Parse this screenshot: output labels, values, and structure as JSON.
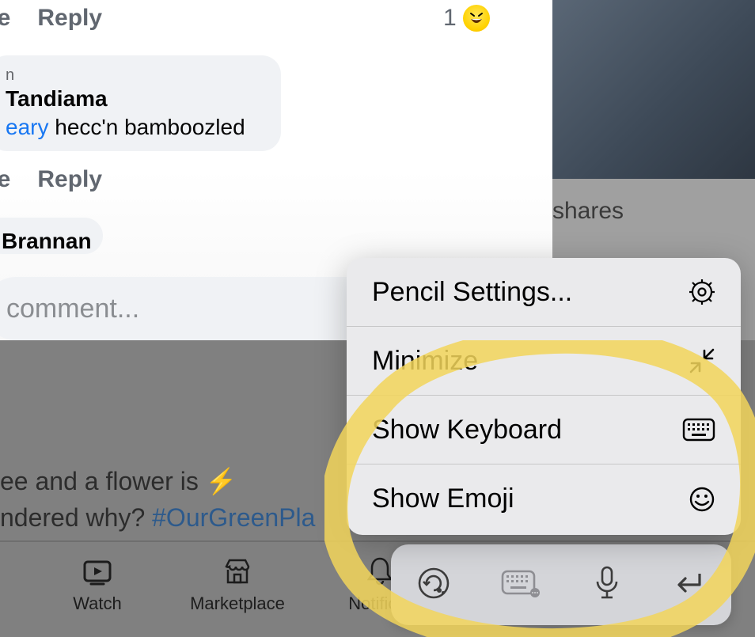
{
  "comments": {
    "actions": {
      "like": "ke",
      "reply": "Reply"
    },
    "reaction_count": "1",
    "bubble1": {
      "meta": "n",
      "author_fragment": " Tandiama",
      "mention_fragment": "eary",
      "body_rest": " hecc'n bamboozled"
    },
    "bubble2": {
      "author_fragment": "Brannan"
    },
    "compose_placeholder": "comment..."
  },
  "right": {
    "shares_label": "shares"
  },
  "post_below": {
    "line_left": "ee and a flower is ",
    "line2_left": "ndered why? ",
    "hashtag": "#OurGreenPla"
  },
  "nav": {
    "watch": "Watch",
    "marketplace": "Marketplace",
    "notifications": "Notificat"
  },
  "popover": {
    "pencil_settings": "Pencil Settings...",
    "minimize": "Minimize",
    "show_keyboard": "Show Keyboard",
    "show_emoji": "Show Emoji"
  }
}
